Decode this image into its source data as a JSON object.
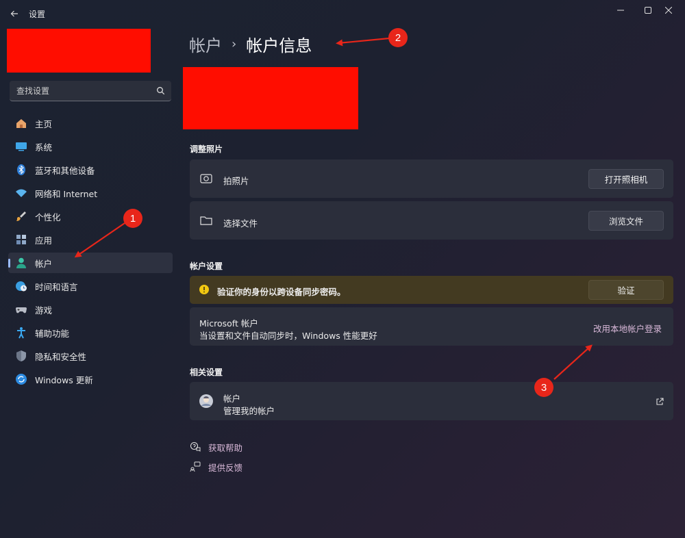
{
  "window": {
    "title": "设置"
  },
  "search": {
    "placeholder": "查找设置"
  },
  "sidebar": {
    "items": [
      {
        "label": "主页",
        "icon": "home-icon"
      },
      {
        "label": "系统",
        "icon": "system-icon"
      },
      {
        "label": "蓝牙和其他设备",
        "icon": "bluetooth-icon"
      },
      {
        "label": "网络和 Internet",
        "icon": "wifi-icon"
      },
      {
        "label": "个性化",
        "icon": "brush-icon"
      },
      {
        "label": "应用",
        "icon": "apps-icon"
      },
      {
        "label": "帐户",
        "icon": "account-icon",
        "active": true
      },
      {
        "label": "时间和语言",
        "icon": "globe-clock-icon"
      },
      {
        "label": "游戏",
        "icon": "gamepad-icon"
      },
      {
        "label": "辅助功能",
        "icon": "accessibility-icon"
      },
      {
        "label": "隐私和安全性",
        "icon": "shield-icon"
      },
      {
        "label": "Windows 更新",
        "icon": "update-icon"
      }
    ]
  },
  "breadcrumb": {
    "parent": "帐户",
    "separator": "›",
    "current": "帐户信息"
  },
  "photo": {
    "section_label": "调整照片",
    "take_photo_label": "拍照片",
    "open_camera_button": "打开照相机",
    "choose_file_label": "选择文件",
    "browse_button": "浏览文件"
  },
  "account_settings": {
    "section_label": "帐户设置",
    "warning_text": "验证你的身份以跨设备同步密码。",
    "verify_button": "验证",
    "ms_title": "Microsoft 帐户",
    "ms_subtitle": "当设置和文件自动同步时，Windows 性能更好",
    "local_login_link": "改用本地帐户登录"
  },
  "related": {
    "section_label": "相关设置",
    "accounts_title": "帐户",
    "accounts_subtitle": "管理我的帐户"
  },
  "help": {
    "get_help": "获取帮助",
    "feedback": "提供反馈"
  },
  "annotations": {
    "badge1": "1",
    "badge2": "2",
    "badge3": "3",
    "color": "#e8261a"
  },
  "colors": {
    "redaction": "#ff0d00",
    "accent": "#9bbcff",
    "link": "#d8b8d8",
    "warning_bg": "#433a21"
  }
}
